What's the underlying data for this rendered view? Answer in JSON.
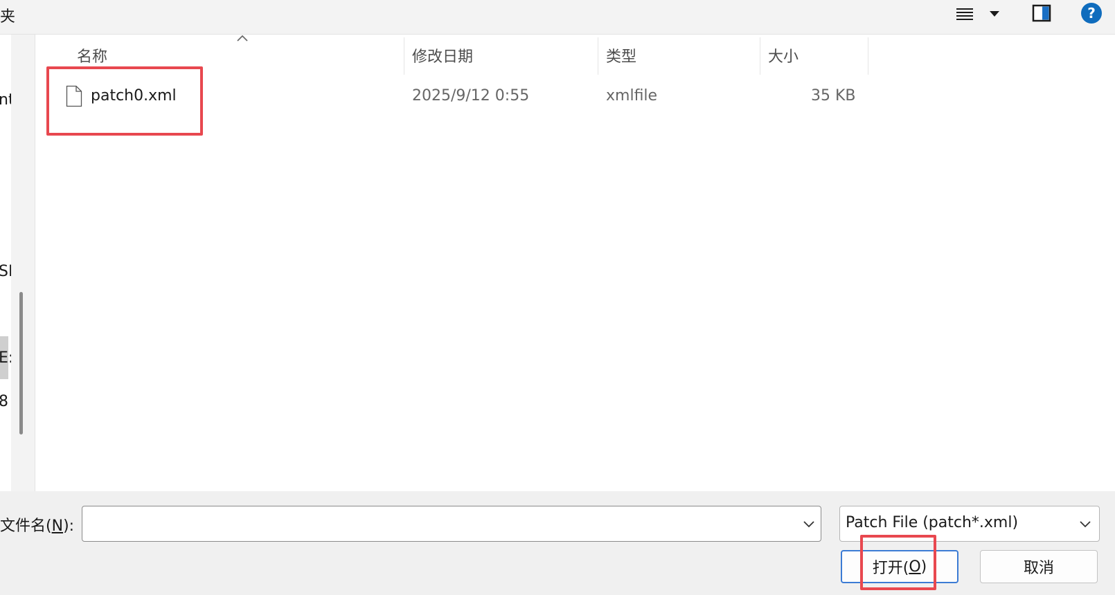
{
  "toolbar": {
    "title_fragment": "夹",
    "icons": [
      "view-menu-icon",
      "chevron-down-icon",
      "preview-pane-icon",
      "help-icon"
    ],
    "help_glyph": "?"
  },
  "nav": {
    "fragments": [
      "nt",
      "SD",
      "E:",
      "8"
    ]
  },
  "file_list": {
    "columns": [
      {
        "label": "名称"
      },
      {
        "label": "修改日期"
      },
      {
        "label": "类型"
      },
      {
        "label": "大小"
      }
    ],
    "sort_indicator": "ascending",
    "rows": [
      {
        "name": "patch0.xml",
        "date": "2025/9/12 0:55",
        "type": "xmlfile",
        "size": "35 KB",
        "icon": "file-icon"
      }
    ]
  },
  "footer": {
    "filename_label": "文件名(",
    "filename_accel": "N",
    "filename_label_end": "):",
    "filename_value": "",
    "filetype_value": "Patch File (patch*.xml)",
    "open_label": "打开(",
    "open_accel": "O",
    "open_label_end": ")",
    "cancel_label": "取消"
  },
  "colors": {
    "highlight": "#e8484f",
    "accent": "#0f6cbd",
    "primary_button_border": "#3b7bd4"
  }
}
